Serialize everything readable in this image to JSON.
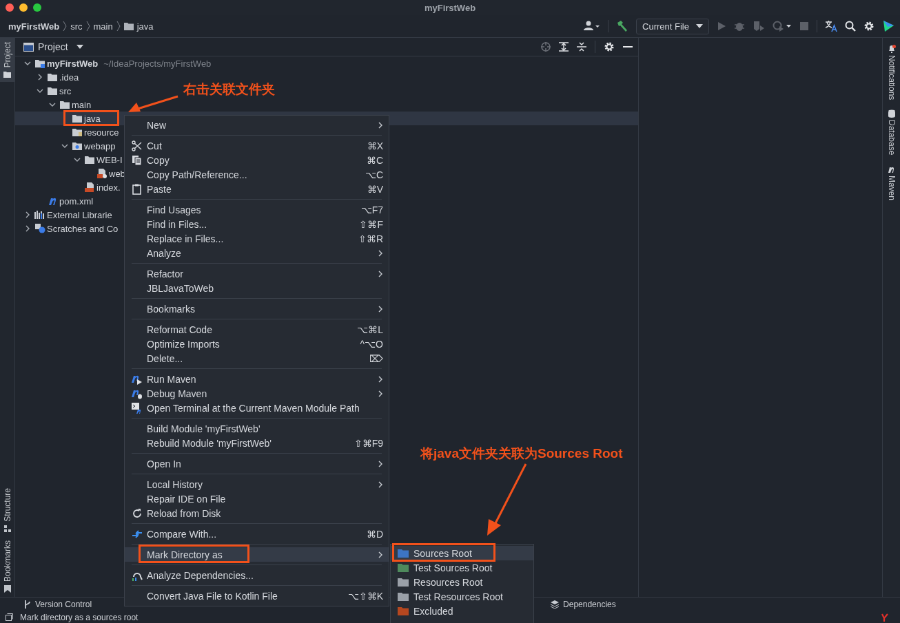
{
  "window": {
    "title": "myFirstWeb"
  },
  "breadcrumb": [
    {
      "label": "myFirstWeb",
      "kind": "plain"
    },
    {
      "label": "src",
      "kind": "plain"
    },
    {
      "label": "main",
      "kind": "plain"
    },
    {
      "label": "java",
      "kind": "folder"
    }
  ],
  "toolbar": {
    "run_config": "Current File"
  },
  "left_strip": {
    "top": [
      {
        "label": "Project",
        "selected": true
      }
    ],
    "bottom": [
      {
        "label": "Structure",
        "selected": false
      },
      {
        "label": "Bookmarks",
        "selected": false
      }
    ]
  },
  "project_panel": {
    "title": "Project",
    "tree": [
      {
        "label": "myFirstWeb",
        "path": "~/IdeaProjects/myFirstWeb",
        "kind": "module",
        "expanded": true,
        "selected": false,
        "children": [
          {
            "label": ".idea",
            "kind": "folder",
            "expanded": false,
            "selected": false
          },
          {
            "label": "src",
            "kind": "folder",
            "expanded": true,
            "selected": false,
            "children": [
              {
                "label": "main",
                "kind": "folder",
                "expanded": true,
                "selected": false,
                "children": [
                  {
                    "label": "java",
                    "kind": "folder",
                    "selected": true
                  },
                  {
                    "label": "resource",
                    "kind": "resources",
                    "selected": false
                  },
                  {
                    "label": "webapp",
                    "kind": "web",
                    "expanded": true,
                    "selected": false,
                    "children": [
                      {
                        "label": "WEB-I",
                        "kind": "folder",
                        "expanded": true,
                        "selected": false,
                        "children": [
                          {
                            "label": "web",
                            "kind": "xml",
                            "selected": false
                          }
                        ]
                      },
                      {
                        "label": "index.",
                        "kind": "jsp",
                        "selected": false
                      }
                    ]
                  }
                ]
              }
            ]
          },
          {
            "label": "pom.xml",
            "kind": "maven",
            "selected": false
          }
        ]
      },
      {
        "label": "External Librarie",
        "kind": "library",
        "expanded": false,
        "selected": false
      },
      {
        "label": "Scratches and Co",
        "kind": "scratch",
        "expanded": false,
        "selected": false
      }
    ]
  },
  "right_strip": [
    {
      "label": "Notifications",
      "kind": "bell",
      "unread": true
    },
    {
      "label": "Database",
      "kind": "database"
    },
    {
      "label": "Maven",
      "kind": "maven"
    }
  ],
  "context_menu": [
    [
      {
        "label": "New",
        "submenu": true,
        "selected": false
      }
    ],
    [
      {
        "label": "Cut",
        "kind": "cut",
        "shortcut": "⌘X",
        "selected": false
      },
      {
        "label": "Copy",
        "kind": "copy",
        "shortcut": "⌘C",
        "selected": false
      },
      {
        "label": "Copy Path/Reference...",
        "shortcut": "⌥C",
        "selected": false
      },
      {
        "label": "Paste",
        "kind": "paste",
        "shortcut": "⌘V",
        "selected": false
      }
    ],
    [
      {
        "label": "Find Usages",
        "shortcut": "⌥F7",
        "selected": false
      },
      {
        "label": "Find in Files...",
        "shortcut": "⇧⌘F",
        "selected": false
      },
      {
        "label": "Replace in Files...",
        "shortcut": "⇧⌘R",
        "selected": false
      },
      {
        "label": "Analyze",
        "submenu": true,
        "selected": false
      }
    ],
    [
      {
        "label": "Refactor",
        "submenu": true,
        "selected": false
      },
      {
        "label": "JBLJavaToWeb",
        "selected": false
      }
    ],
    [
      {
        "label": "Bookmarks",
        "submenu": true,
        "selected": false
      }
    ],
    [
      {
        "label": "Reformat Code",
        "shortcut": "⌥⌘L",
        "selected": false
      },
      {
        "label": "Optimize Imports",
        "shortcut": "^⌥O",
        "selected": false
      },
      {
        "label": "Delete...",
        "shortcut": "⌦",
        "selected": false
      }
    ],
    [
      {
        "label": "Run Maven",
        "kind": "maven-run",
        "submenu": true,
        "selected": false
      },
      {
        "label": "Debug Maven",
        "kind": "maven-debug",
        "submenu": true,
        "selected": false
      },
      {
        "label": "Open Terminal at the Current Maven Module Path",
        "kind": "terminal",
        "selected": false
      }
    ],
    [
      {
        "label": "Build Module 'myFirstWeb'",
        "selected": false
      },
      {
        "label": "Rebuild Module 'myFirstWeb'",
        "shortcut": "⇧⌘F9",
        "selected": false
      }
    ],
    [
      {
        "label": "Open In",
        "submenu": true,
        "selected": false
      }
    ],
    [
      {
        "label": "Local History",
        "submenu": true,
        "selected": false
      },
      {
        "label": "Repair IDE on File",
        "selected": false
      },
      {
        "label": "Reload from Disk",
        "kind": "reload",
        "selected": false
      }
    ],
    [
      {
        "label": "Compare With...",
        "kind": "compare",
        "shortcut": "⌘D",
        "selected": false
      }
    ],
    [
      {
        "label": "Mark Directory as",
        "submenu": true,
        "selected": true
      }
    ],
    [
      {
        "label": "Analyze Dependencies...",
        "kind": "analyze",
        "selected": false
      }
    ],
    [
      {
        "label": "Convert Java File to Kotlin File",
        "shortcut": "⌥⇧⌘K",
        "selected": false
      }
    ]
  ],
  "submenu": [
    {
      "label": "Sources Root",
      "color": "#3d74c4",
      "selected": true
    },
    {
      "label": "Test Sources Root",
      "color": "#4e8a5c",
      "selected": false
    },
    {
      "label": "Resources Root",
      "color": "#9aa0a8",
      "selected": false
    },
    {
      "label": "Test Resources Root",
      "color": "#9aa0a8",
      "selected": false
    },
    {
      "label": "Excluded",
      "color": "#b5471f",
      "selected": false
    }
  ],
  "bottom_tabs": [
    {
      "label": "Version Control",
      "kind": "vcs"
    },
    {
      "label": "Dependencies",
      "kind": "deps"
    }
  ],
  "status_bar": {
    "message": "Mark directory as a sources root"
  },
  "annotations": [
    {
      "text": "右击关联文件夹"
    },
    {
      "text": "将java文件夹关联为Sources Root"
    }
  ]
}
